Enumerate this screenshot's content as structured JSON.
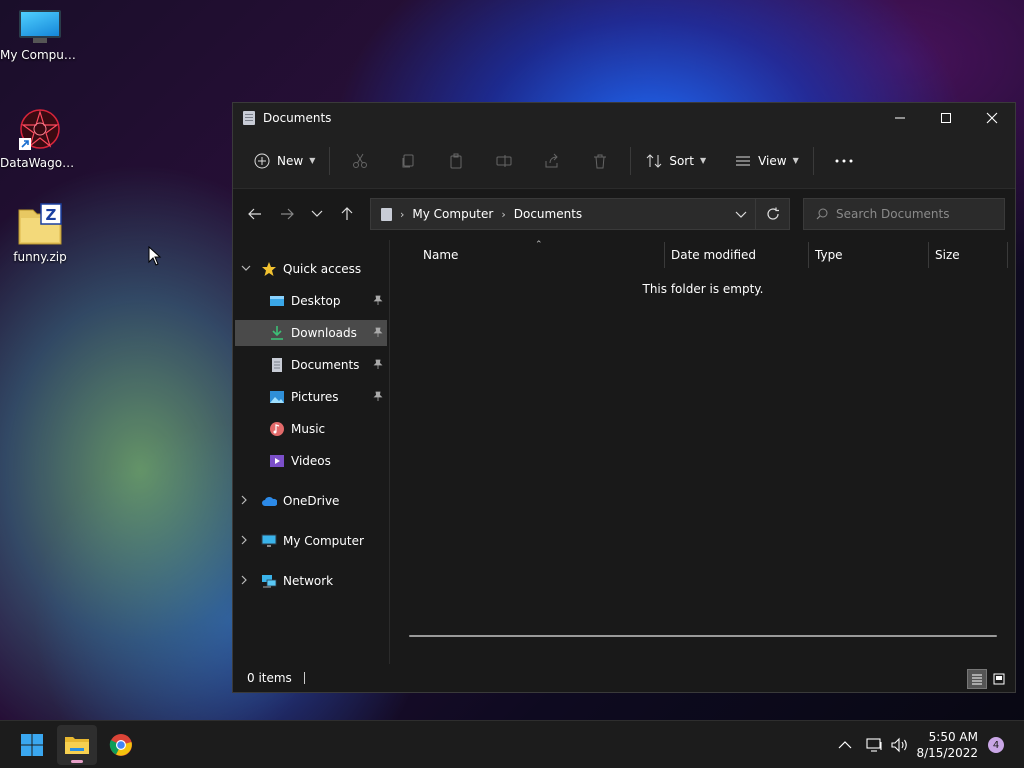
{
  "desktop": {
    "icons": [
      {
        "label": "My Computer",
        "icon": "monitor-icon"
      },
      {
        "label": "DataWagon...",
        "icon": "datawagon-icon"
      },
      {
        "label": "funny.zip",
        "icon": "zip-file-icon"
      }
    ]
  },
  "window": {
    "title": "Documents",
    "controls": {
      "minimize": "minimize-icon",
      "maximize": "maximize-icon",
      "close": "close-icon"
    }
  },
  "toolbar": {
    "new_label": "New",
    "sort_label": "Sort",
    "view_label": "View",
    "icons": [
      "cut-icon",
      "copy-icon",
      "paste-icon",
      "rename-icon",
      "share-icon",
      "delete-icon"
    ]
  },
  "address": {
    "crumbs": [
      "My Computer",
      "Documents"
    ],
    "search_placeholder": "Search Documents"
  },
  "sidebar": {
    "quick_access": "Quick access",
    "items": [
      {
        "label": "Desktop",
        "pinned": true
      },
      {
        "label": "Downloads",
        "pinned": true,
        "selected": true
      },
      {
        "label": "Documents",
        "pinned": true
      },
      {
        "label": "Pictures",
        "pinned": true
      },
      {
        "label": "Music",
        "pinned": false
      },
      {
        "label": "Videos",
        "pinned": false
      }
    ],
    "roots": [
      "OneDrive",
      "My Computer",
      "Network"
    ]
  },
  "columns": [
    "Name",
    "Date modified",
    "Type",
    "Size"
  ],
  "content": {
    "empty_message": "This folder is empty."
  },
  "status": {
    "item_count": "0 items"
  },
  "taskbar": {
    "time": "5:50 AM",
    "date": "8/15/2022",
    "notification_count": "4"
  },
  "colors": {
    "accent": "#60cdff",
    "selected": "#4a4a4a",
    "window_bg": "#191919",
    "taskbar_bg": "#1c1c1c"
  }
}
